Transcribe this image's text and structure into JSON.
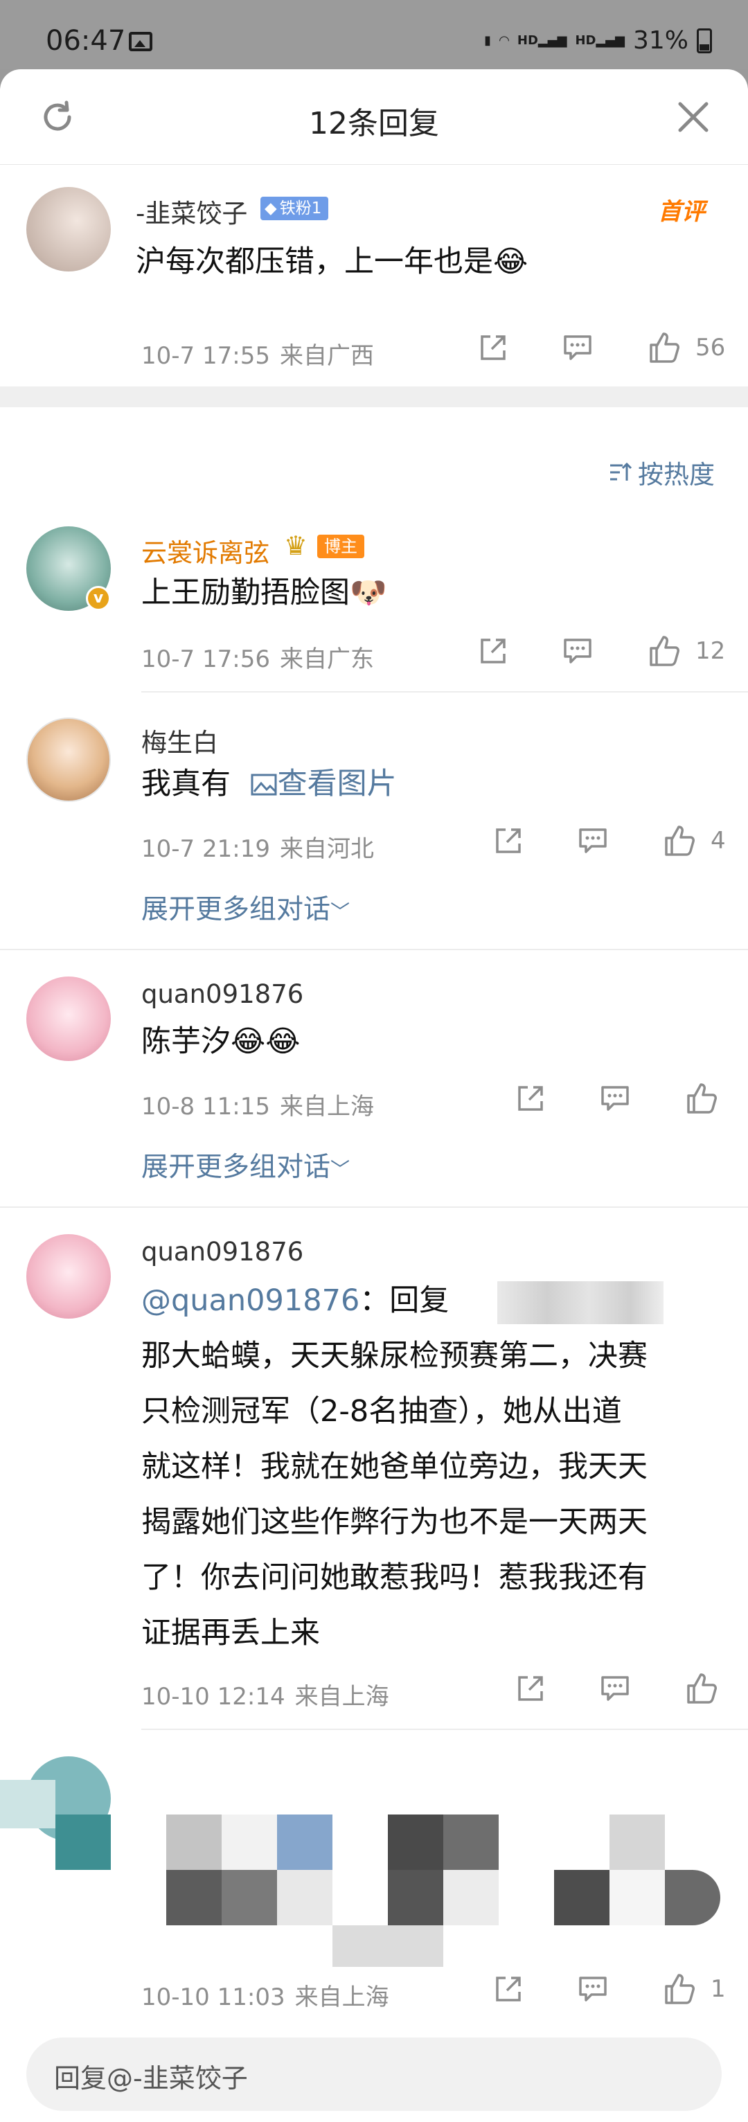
{
  "status_bar": {
    "time": "06:47",
    "battery": "31%"
  },
  "header": {
    "title": "12条回复"
  },
  "root_comment": {
    "user": "-韭菜饺子",
    "badge": "铁粉1",
    "tag": "首评",
    "text": "沪每次都压错，上一年也是😂",
    "time": "10-7 17:55",
    "location": "来自广西",
    "likes": "56"
  },
  "sort": {
    "label": "按热度"
  },
  "replies": [
    {
      "user": "云裳诉离弦",
      "badge": "博主",
      "text": "上王励勤捂脸图🐶",
      "time": "10-7 17:56",
      "location": "来自广东",
      "likes": "12"
    },
    {
      "user": "梅生白",
      "text": "我真有",
      "link": "查看图片",
      "time": "10-7 21:19",
      "location": "来自河北",
      "likes": "4",
      "expand": "展开更多组对话"
    },
    {
      "user": "quan091876",
      "text": "陈芋汐😂😂",
      "time": "10-8 11:15",
      "location": "来自上海",
      "likes": "",
      "expand": "展开更多组对话"
    },
    {
      "user": "quan091876",
      "mention": "@quan091876",
      "text_1": "：回复",
      "line_2": "那大蛤蟆，天天躲尿检预赛第二，决赛",
      "line_3": "只检测冠军（2-8名抽查），她从出道",
      "line_4": "就这样！我就在她爸单位旁边，我天天",
      "line_5": "揭露她们这些作弊行为也不是一天两天",
      "line_6": "了！你去问问她敢惹我吗！惹我我还有",
      "line_7": "证据再丢上来",
      "time": "10-10 12:14",
      "location": "来自上海",
      "likes": ""
    },
    {
      "user": "",
      "text": "",
      "time": "10-10 11:03",
      "location": "来自上海",
      "likes": "1"
    }
  ],
  "reply_box": {
    "placeholder": "回复@-韭菜饺子"
  },
  "colors": {
    "link": "#557a9f",
    "accent": "#ff8d1a",
    "meta": "#8d8d8d"
  }
}
